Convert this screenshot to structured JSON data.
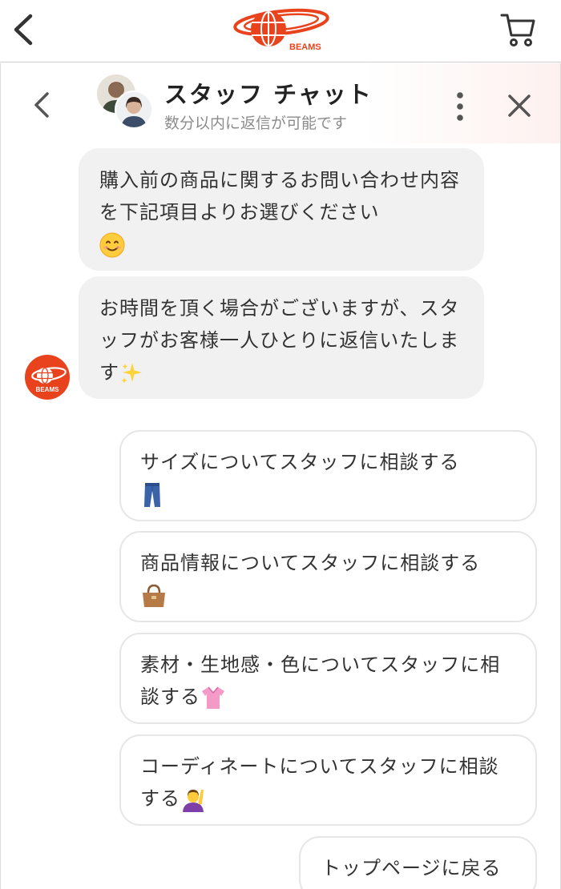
{
  "app_header": {
    "logo_text": "BEAMS",
    "brand_color": "#e8431c",
    "icons": [
      "chevron-left-icon",
      "cart-icon"
    ]
  },
  "chat": {
    "title": "スタッフ チャット",
    "subtitle": "数分以内に返信が可能です",
    "messages": [
      {
        "text": "購入前の商品に関するお問い合わせ内容を下記項目よりお選びください",
        "emoji": "smiling-face-icon"
      },
      {
        "text": "お時間を頂く場合がございますが、スタッフがお客様一人ひとりに返信いたします",
        "emoji": "sparkles-icon"
      }
    ],
    "bot_avatar_label": "BEAMS",
    "options": [
      {
        "label": "サイズについてスタッフに相談する",
        "emoji": "jeans-icon"
      },
      {
        "label": "商品情報についてスタッフに相談する",
        "emoji": "handbag-icon"
      },
      {
        "label": "素材・生地感・色についてスタッフに相談する",
        "emoji": "blouse-icon"
      },
      {
        "label": "コーディネートについてスタッフに相談する",
        "emoji": "person-raising-hand-icon"
      }
    ],
    "back_to_top_label": "トップページに戻る"
  }
}
